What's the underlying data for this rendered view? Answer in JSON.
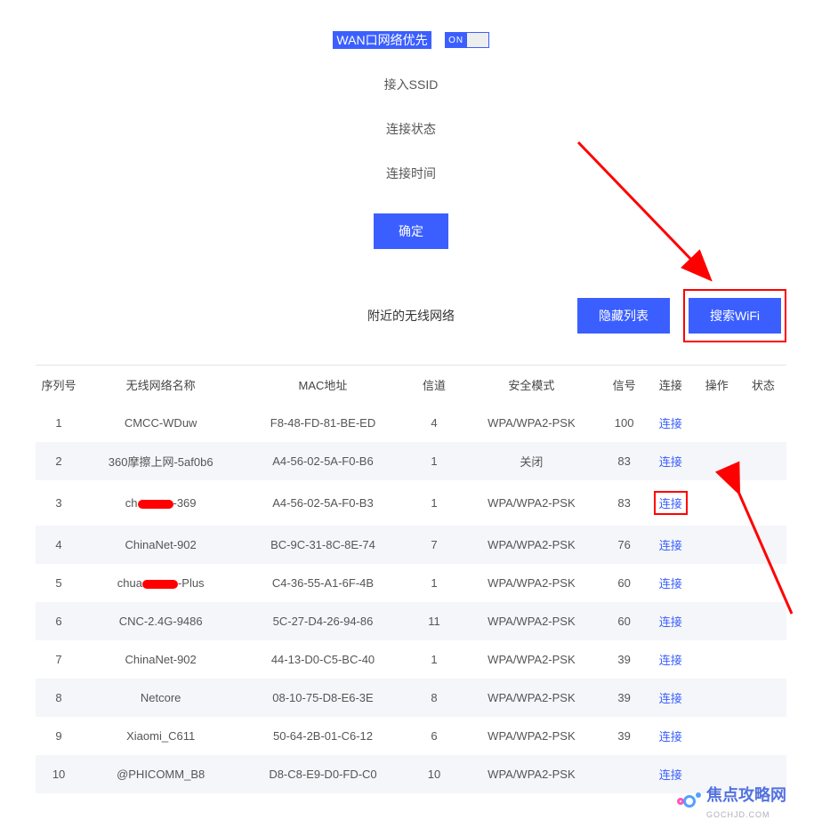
{
  "form": {
    "wan_priority_label": "WAN口网络优先",
    "toggle_state": "ON",
    "ssid_label": "接入SSID",
    "conn_status_label": "连接状态",
    "conn_time_label": "连接时间",
    "confirm_label": "确定"
  },
  "section": {
    "nearby_label": "附近的无线网络",
    "hide_list_label": "隐藏列表",
    "search_wifi_label": "搜索WiFi"
  },
  "table": {
    "headers": {
      "idx": "序列号",
      "name": "无线网络名称",
      "mac": "MAC地址",
      "channel": "信道",
      "security": "安全模式",
      "signal": "信号",
      "connect": "连接",
      "operate": "操作",
      "status": "状态"
    },
    "connect_label": "连接",
    "rows": [
      {
        "idx": "1",
        "name": "CMCC-WDuw",
        "mac": "F8-48-FD-81-BE-ED",
        "channel": "4",
        "security": "WPA/WPA2-PSK",
        "signal": "100"
      },
      {
        "idx": "2",
        "name": "360摩擦上网-5af0b6",
        "mac": "A4-56-02-5A-F0-B6",
        "channel": "1",
        "security": "关闭",
        "signal": "83"
      },
      {
        "idx": "3",
        "name_prefix": "ch",
        "name_suffix": "-369",
        "redacted": true,
        "mac": "A4-56-02-5A-F0-B3",
        "channel": "1",
        "security": "WPA/WPA2-PSK",
        "signal": "83",
        "highlight_connect": true
      },
      {
        "idx": "4",
        "name": "ChinaNet-902",
        "mac": "BC-9C-31-8C-8E-74",
        "channel": "7",
        "security": "WPA/WPA2-PSK",
        "signal": "76"
      },
      {
        "idx": "5",
        "name_prefix": "chua",
        "name_suffix": "-Plus",
        "redacted": true,
        "mac": "C4-36-55-A1-6F-4B",
        "channel": "1",
        "security": "WPA/WPA2-PSK",
        "signal": "60"
      },
      {
        "idx": "6",
        "name": "CNC-2.4G-9486",
        "mac": "5C-27-D4-26-94-86",
        "channel": "11",
        "security": "WPA/WPA2-PSK",
        "signal": "60"
      },
      {
        "idx": "7",
        "name": "ChinaNet-902",
        "mac": "44-13-D0-C5-BC-40",
        "channel": "1",
        "security": "WPA/WPA2-PSK",
        "signal": "39"
      },
      {
        "idx": "8",
        "name": "Netcore",
        "mac": "08-10-75-D8-E6-3E",
        "channel": "8",
        "security": "WPA/WPA2-PSK",
        "signal": "39"
      },
      {
        "idx": "9",
        "name": "Xiaomi_C611",
        "mac": "50-64-2B-01-C6-12",
        "channel": "6",
        "security": "WPA/WPA2-PSK",
        "signal": "39"
      },
      {
        "idx": "10",
        "name": "@PHICOMM_B8",
        "mac": "D8-C8-E9-D0-FD-C0",
        "channel": "10",
        "security": "WPA/WPA2-PSK",
        "signal": ""
      }
    ]
  },
  "watermark": {
    "main": "焦点攻略网",
    "sub": "GOCHJD.COM"
  }
}
